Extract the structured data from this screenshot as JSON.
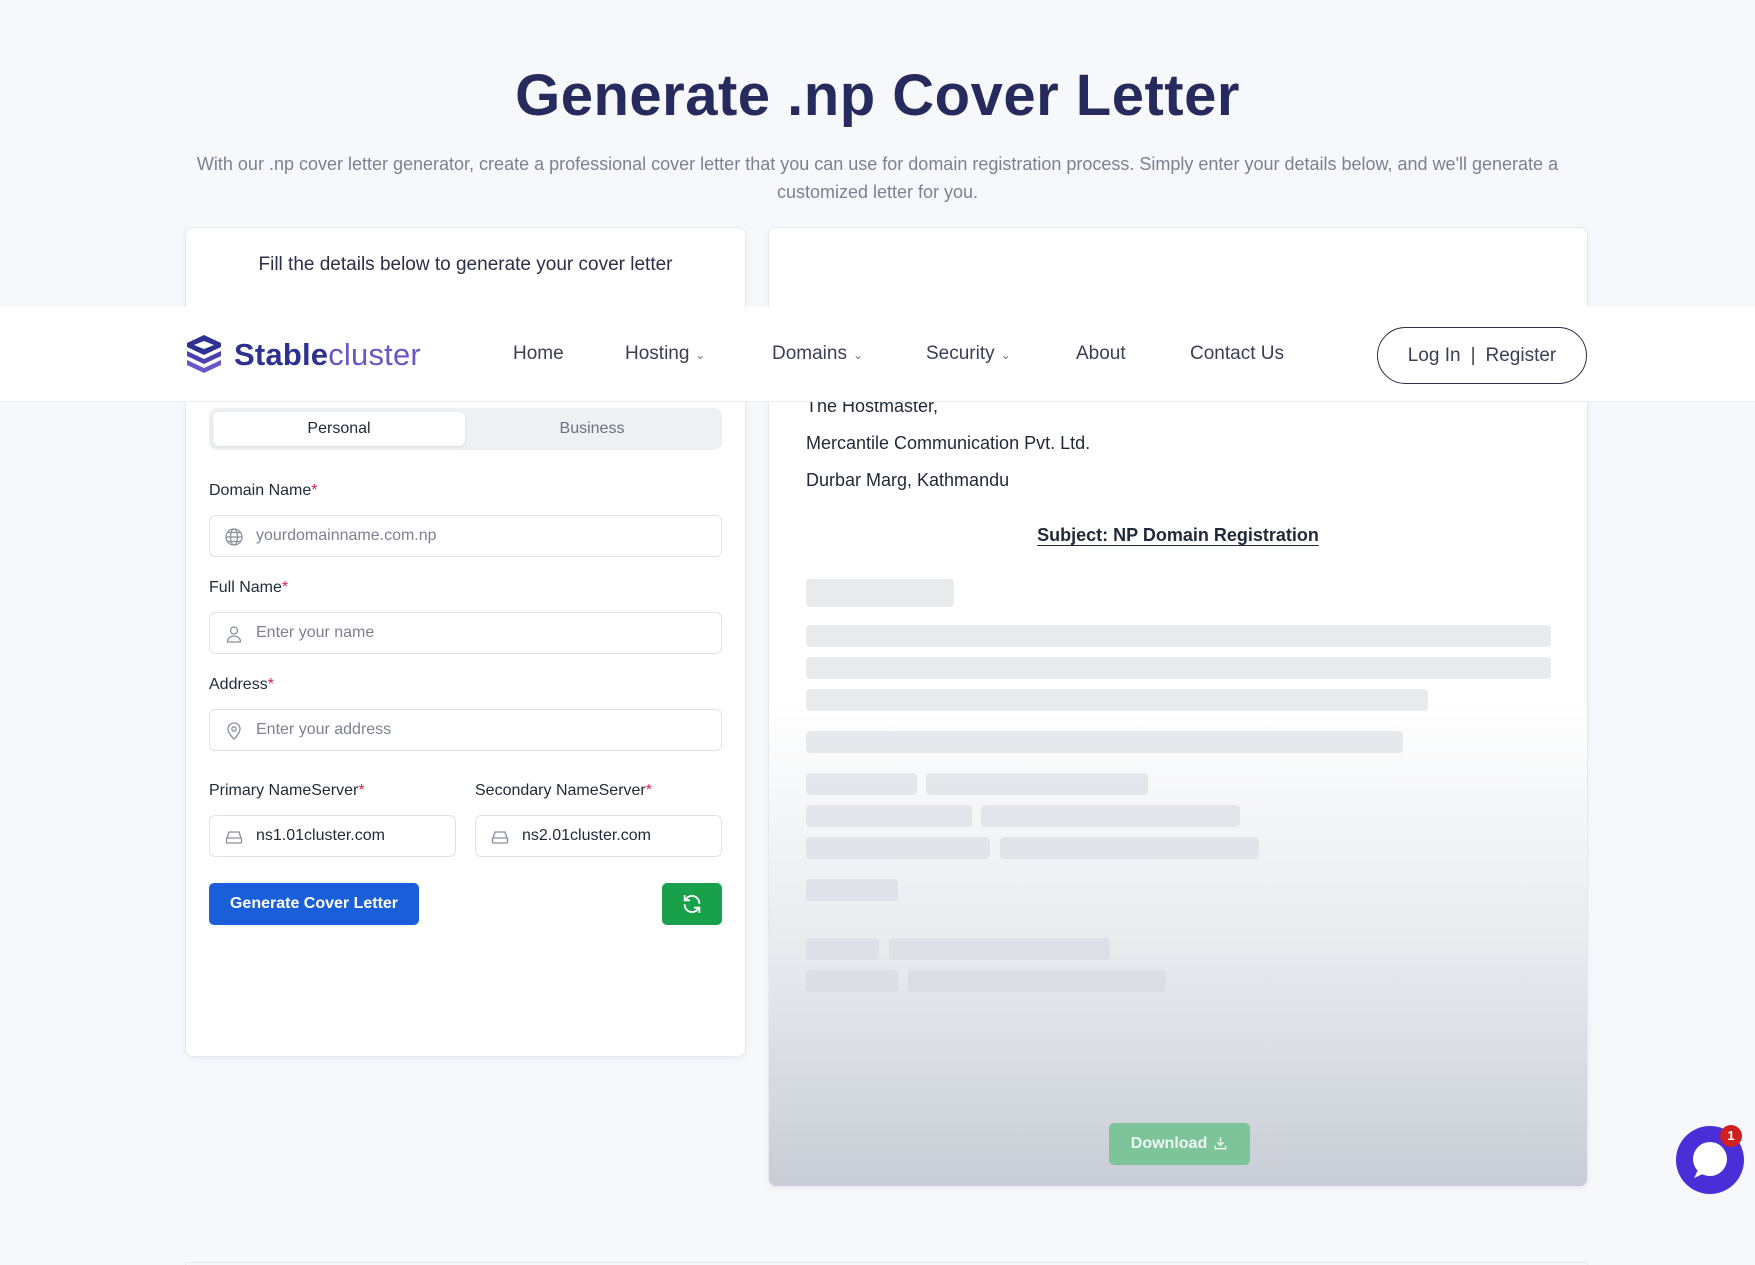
{
  "hero": {
    "title": "Generate .np Cover Letter",
    "subtitle": "With our .np cover letter generator, create a professional cover letter that you can use for domain registration process. Simply enter your details below, and we'll generate a customized letter for you."
  },
  "form": {
    "heading": "Fill the details below to generate your cover letter",
    "tabs": {
      "personal": "Personal",
      "business": "Business",
      "active": "Personal"
    },
    "domain": {
      "label": "Domain Name",
      "placeholder": "yourdomainname.com.np",
      "value": ""
    },
    "full_name": {
      "label": "Full Name",
      "placeholder": "Enter your name",
      "value": ""
    },
    "address": {
      "label": "Address",
      "placeholder": "Enter your address",
      "value": ""
    },
    "primary_ns": {
      "label": "Primary NameServer",
      "value": "ns1.01cluster.com"
    },
    "secondary_ns": {
      "label": "Secondary NameServer",
      "value": "ns2.01cluster.com"
    },
    "required_mark": "*",
    "generate_label": "Generate Cover Letter",
    "refresh_icon": "refresh-icon"
  },
  "preview": {
    "recipient": [
      "The Hostmaster,",
      "Mercantile Communication Pvt. Ltd.",
      "Durbar Marg, Kathmandu"
    ],
    "subject": "Subject: NP Domain Registration",
    "download_label": "Download"
  },
  "navbar": {
    "logo_bold": "Stable",
    "logo_light": "cluster",
    "items": [
      {
        "label": "Home",
        "dropdown": false
      },
      {
        "label": "Hosting",
        "dropdown": true
      },
      {
        "label": "Domains",
        "dropdown": true
      },
      {
        "label": "Security",
        "dropdown": true
      },
      {
        "label": "About",
        "dropdown": false
      },
      {
        "label": "Contact Us",
        "dropdown": false
      }
    ],
    "login": "Log In",
    "divider": "|",
    "register": "Register"
  },
  "chat": {
    "badge_count": "1"
  },
  "colors": {
    "primary_blue": "#1a5fd9",
    "refresh_green": "#19a04a",
    "brand_navy": "#2d3290",
    "brand_purple": "#6a56c6",
    "chat_purple": "#4a2fd8"
  }
}
